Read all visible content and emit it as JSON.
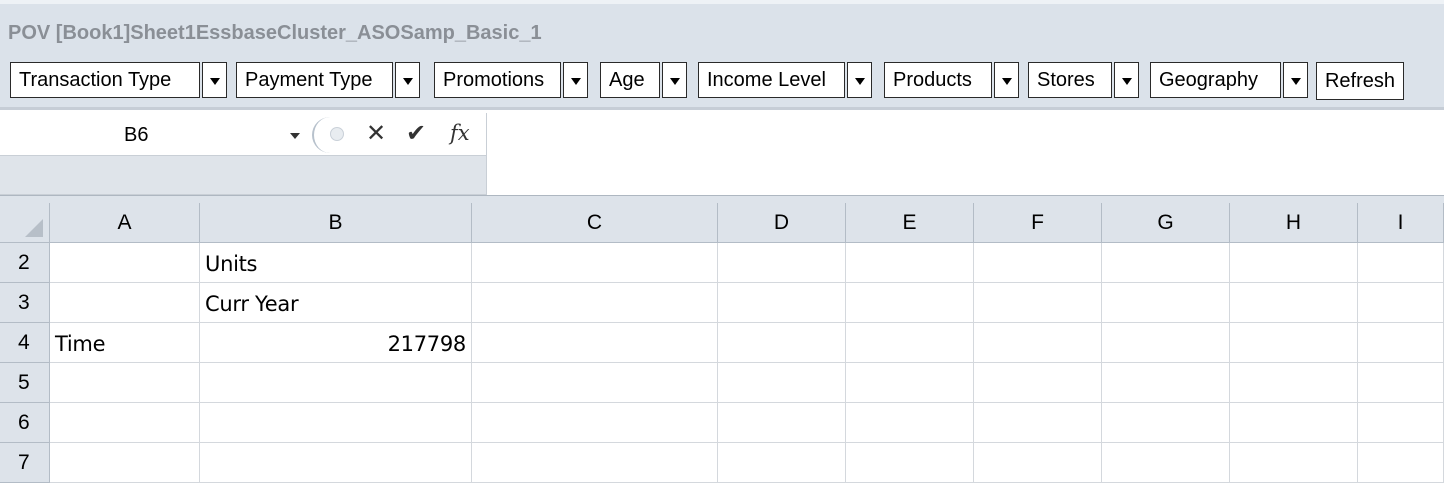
{
  "pov": {
    "title": "POV [Book1]Sheet1EssbaseCluster_ASOSamp_Basic_1",
    "dimensions": [
      {
        "label": "Transaction Type"
      },
      {
        "label": "Payment Type"
      },
      {
        "label": "Promotions"
      },
      {
        "label": "Age"
      },
      {
        "label": "Income Level"
      },
      {
        "label": "Products"
      },
      {
        "label": "Stores"
      },
      {
        "label": "Geography"
      }
    ],
    "refresh_label": "Refresh"
  },
  "formula_bar": {
    "name_box": "B6",
    "icons": [
      "dropdown-icon",
      "cancel-icon",
      "enter-icon",
      "insert-function-icon"
    ],
    "cancel_glyph": "✕",
    "enter_glyph": "✔",
    "fx_glyph": "fx",
    "formula": ""
  },
  "grid": {
    "columns": [
      "A",
      "B",
      "C",
      "D",
      "E",
      "F",
      "G",
      "H",
      "I"
    ],
    "rows": [
      {
        "num": "2",
        "cells": [
          "",
          "Units",
          "",
          "",
          "",
          "",
          "",
          "",
          ""
        ]
      },
      {
        "num": "3",
        "cells": [
          "",
          "Curr Year",
          "",
          "",
          "",
          "",
          "",
          "",
          ""
        ]
      },
      {
        "num": "4",
        "cells": [
          "Time",
          "217798",
          "",
          "",
          "",
          "",
          "",
          "",
          ""
        ]
      },
      {
        "num": "5",
        "cells": [
          "",
          "",
          "",
          "",
          "",
          "",
          "",
          "",
          ""
        ]
      },
      {
        "num": "6",
        "cells": [
          "",
          "",
          "",
          "",
          "",
          "",
          "",
          "",
          ""
        ]
      },
      {
        "num": "7",
        "cells": [
          "",
          "",
          "",
          "",
          "",
          "",
          "",
          "",
          ""
        ]
      }
    ]
  },
  "colors": {
    "toolbar_bg": "#dbe2ea",
    "header_bg": "#dde3ea",
    "gridline": "#d4d8dd"
  }
}
